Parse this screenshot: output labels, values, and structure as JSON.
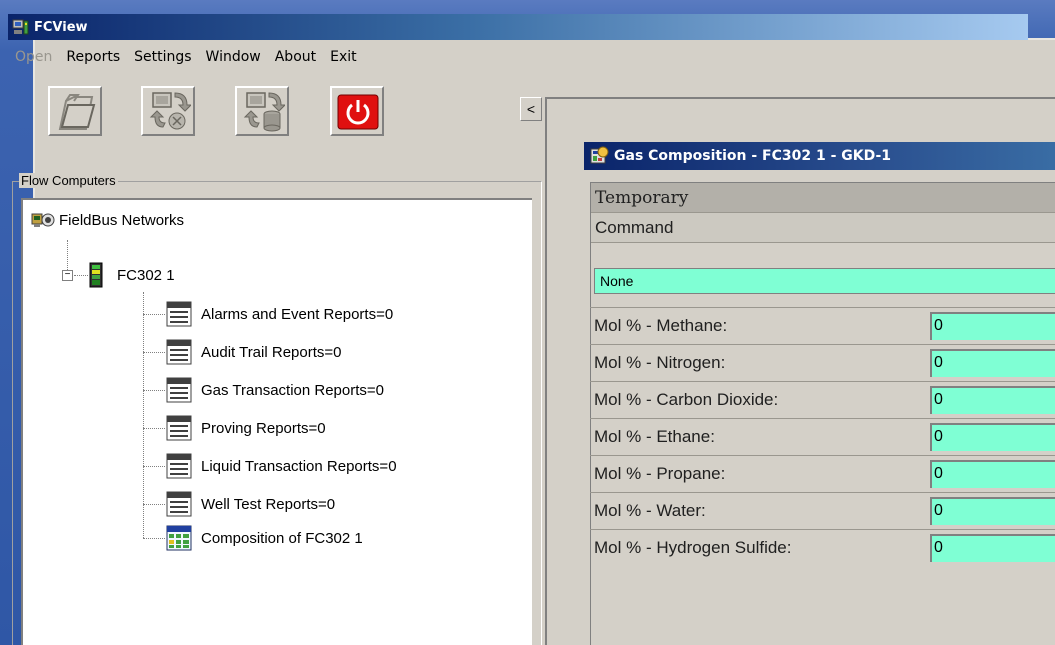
{
  "app": {
    "title": "FCView",
    "menu": [
      {
        "label": "Open",
        "disabled": true
      },
      {
        "label": "Reports",
        "disabled": false
      },
      {
        "label": "Settings",
        "disabled": false
      },
      {
        "label": "Window",
        "disabled": false
      },
      {
        "label": "About",
        "disabled": false
      },
      {
        "label": "Exit",
        "disabled": false
      }
    ],
    "toolbar": {
      "open_icon": "folder-icon",
      "connect_icon": "network-transfer-icon",
      "db_icon": "database-transfer-icon",
      "power_icon": "power-icon",
      "collapse_label": "<"
    }
  },
  "flow_computers": {
    "legend": "Flow Computers",
    "root": "FieldBus Networks",
    "device": "FC302 1",
    "expander": "−",
    "items": [
      {
        "label": "Alarms and Event Reports=0",
        "icon": "report-icon"
      },
      {
        "label": "Audit Trail Reports=0",
        "icon": "report-icon"
      },
      {
        "label": "Gas Transaction Reports=0",
        "icon": "report-icon"
      },
      {
        "label": "Proving Reports=0",
        "icon": "report-icon"
      },
      {
        "label": "Liquid Transaction Reports=0",
        "icon": "report-icon"
      },
      {
        "label": "Well Test Reports=0",
        "icon": "report-icon"
      },
      {
        "label": "Composition of FC302 1",
        "icon": "grid-icon"
      }
    ]
  },
  "composition": {
    "title": "Gas Composition - FC302 1 - GKD-1",
    "mode": "Temporary",
    "command_label": "Command",
    "command_value": "None",
    "rows": [
      {
        "label": "Mol % - Methane:",
        "value": "0"
      },
      {
        "label": "Mol % - Nitrogen:",
        "value": "0"
      },
      {
        "label": "Mol % - Carbon Dioxide:",
        "value": "0"
      },
      {
        "label": "Mol % - Ethane:",
        "value": "0"
      },
      {
        "label": "Mol % - Propane:",
        "value": "0"
      },
      {
        "label": "Mol % - Water:",
        "value": "0"
      },
      {
        "label": "Mol % - Hydrogen Sulfide:",
        "value": "0"
      }
    ]
  },
  "colors": {
    "field_bg": "#7fffd4",
    "title_gradient_start": "#0a246a",
    "power_red": "#e01010"
  }
}
